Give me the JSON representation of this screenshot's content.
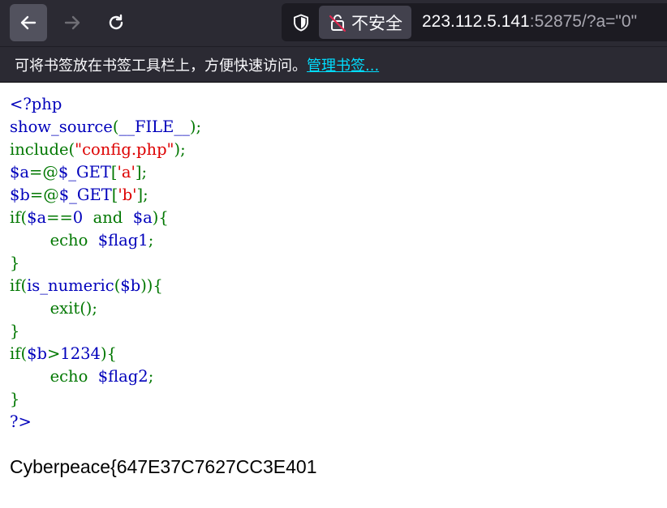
{
  "browser": {
    "security_label": "不安全",
    "url_host": "223.112.5.141",
    "url_rest": ":52875/?a=\"0\"",
    "bookmark_prompt": "可将书签放在书签工具栏上，方便快速访问。",
    "bookmark_link": "管理书签..."
  },
  "colors": {
    "php_default": "#0000bb",
    "php_keyword": "#007700",
    "php_string": "#dd0000"
  },
  "code_lines": [
    [
      {
        "c": "def",
        "t": "<?php"
      }
    ],
    [
      {
        "c": "def",
        "t": "show_source"
      },
      {
        "c": "kw",
        "t": "("
      },
      {
        "c": "def",
        "t": "__FILE__"
      },
      {
        "c": "kw",
        "t": ");"
      }
    ],
    [
      {
        "c": "kw",
        "t": "include("
      },
      {
        "c": "str",
        "t": "\"config.php\""
      },
      {
        "c": "kw",
        "t": ");"
      }
    ],
    [
      {
        "c": "def",
        "t": "$a"
      },
      {
        "c": "kw",
        "t": "=@"
      },
      {
        "c": "def",
        "t": "$_GET"
      },
      {
        "c": "kw",
        "t": "["
      },
      {
        "c": "str",
        "t": "'a'"
      },
      {
        "c": "kw",
        "t": "];"
      }
    ],
    [
      {
        "c": "def",
        "t": "$b"
      },
      {
        "c": "kw",
        "t": "=@"
      },
      {
        "c": "def",
        "t": "$_GET"
      },
      {
        "c": "kw",
        "t": "["
      },
      {
        "c": "str",
        "t": "'b'"
      },
      {
        "c": "kw",
        "t": "];"
      }
    ],
    [
      {
        "c": "kw",
        "t": "if("
      },
      {
        "c": "def",
        "t": "$a"
      },
      {
        "c": "kw",
        "t": "=="
      },
      {
        "c": "def",
        "t": "0  "
      },
      {
        "c": "kw",
        "t": "and  "
      },
      {
        "c": "def",
        "t": "$a"
      },
      {
        "c": "kw",
        "t": "){"
      }
    ],
    [
      {
        "c": "def",
        "t": "        "
      },
      {
        "c": "kw",
        "t": "echo  "
      },
      {
        "c": "def",
        "t": "$flag1"
      },
      {
        "c": "kw",
        "t": ";"
      }
    ],
    [
      {
        "c": "kw",
        "t": "}"
      }
    ],
    [
      {
        "c": "kw",
        "t": "if("
      },
      {
        "c": "def",
        "t": "is_numeric"
      },
      {
        "c": "kw",
        "t": "("
      },
      {
        "c": "def",
        "t": "$b"
      },
      {
        "c": "kw",
        "t": ")){"
      }
    ],
    [
      {
        "c": "def",
        "t": "        "
      },
      {
        "c": "kw",
        "t": "exit();"
      }
    ],
    [
      {
        "c": "kw",
        "t": "}"
      }
    ],
    [
      {
        "c": "kw",
        "t": "if("
      },
      {
        "c": "def",
        "t": "$b"
      },
      {
        "c": "kw",
        "t": ">"
      },
      {
        "c": "def",
        "t": "1234"
      },
      {
        "c": "kw",
        "t": "){"
      }
    ],
    [
      {
        "c": "def",
        "t": "        "
      },
      {
        "c": "kw",
        "t": "echo  "
      },
      {
        "c": "def",
        "t": "$flag2"
      },
      {
        "c": "kw",
        "t": ";"
      }
    ],
    [
      {
        "c": "kw",
        "t": "}"
      }
    ],
    [
      {
        "c": "def",
        "t": "?>"
      }
    ]
  ],
  "page_output": "Cyberpeace{647E37C7627CC3E401"
}
